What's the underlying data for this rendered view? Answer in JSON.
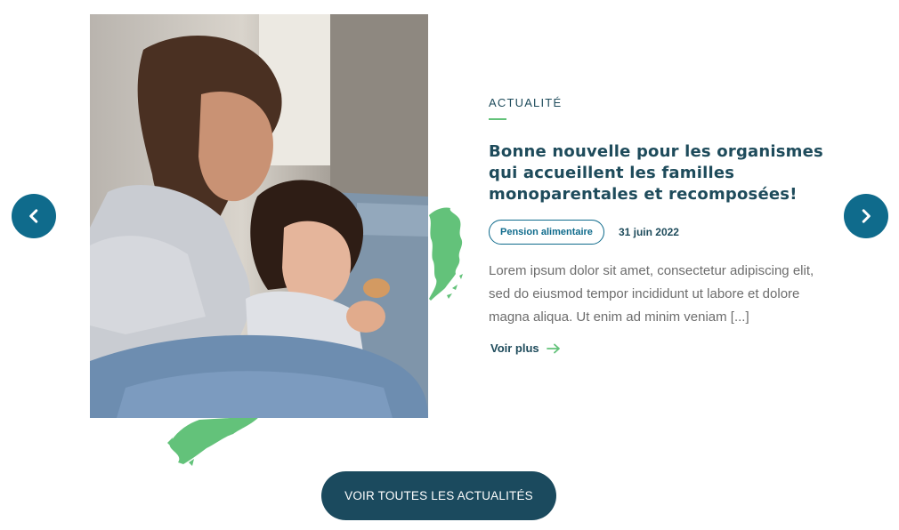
{
  "colors": {
    "accent": "#0f6b8c",
    "navy": "#1b4a5e",
    "brush_green": "#63c27a",
    "body_text": "#6d6d6d"
  },
  "carousel": {
    "prev_icon": "chevron-left-icon",
    "next_icon": "chevron-right-icon"
  },
  "article": {
    "image_alt": "Mother reading with her young daughter on a sofa",
    "category": "ACTUALITÉ",
    "title": "Bonne nouvelle pour les organismes qui accueillent les familles monoparentales et recomposées!",
    "tag": "Pension alimentaire",
    "date": "31 juin 2022",
    "excerpt": "Lorem ipsum dolor sit amet, consectetur adipiscing elit, sed do eiusmod tempor incididunt ut labore et dolore magna aliqua. Ut enim ad minim veniam [...]",
    "more_label": "Voir plus",
    "more_icon": "arrow-right-icon"
  },
  "cta": {
    "label": "VOIR TOUTES LES ACTUALITÉS"
  }
}
